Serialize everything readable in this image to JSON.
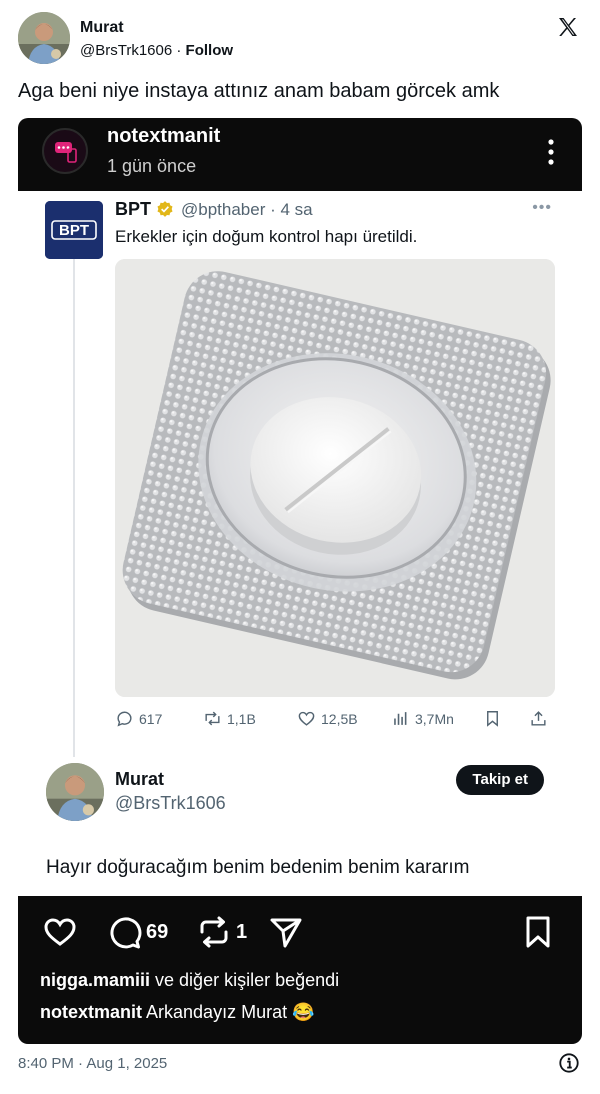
{
  "tweet": {
    "author_name": "Murat",
    "author_handle": "@BrsTrk1606",
    "separator": " · ",
    "follow_label": "Follow",
    "text": "Aga beni niye instaya attınız anam babam görcek amk",
    "timestamp": "8:40 PM · Aug 1, 2025"
  },
  "instagram": {
    "username": "notextmanit",
    "time_ago": "1 gün önce",
    "comments_count": "69",
    "reposts_count": "1",
    "liked_by_user": "nigga.mamiii",
    "liked_by_suffix": " ve diğer kişiler beğendi",
    "caption_user": "notextmanit",
    "caption_text": " Arkandayız Murat 😂"
  },
  "quoted_post": {
    "author_name": "BPT",
    "author_handle": "@bpthaber",
    "age": "· 4 sa",
    "logo_text": "BPT",
    "text": "Erkekler için doğum kontrol hapı üretildi.",
    "stats": {
      "replies": "617",
      "reposts": "1,1B",
      "likes": "12,5B",
      "views": "3,7Mn"
    }
  },
  "reply": {
    "author_name": "Murat",
    "author_handle": "@BrsTrk1606",
    "follow_label": "Takip et",
    "text": "Hayır doğuracağım benim bedenim benim kararım"
  },
  "colors": {
    "verified_gold": "#e2b719",
    "instagram_bar": "#0b0b0b",
    "bpt_blue": "#1b2f6e"
  }
}
